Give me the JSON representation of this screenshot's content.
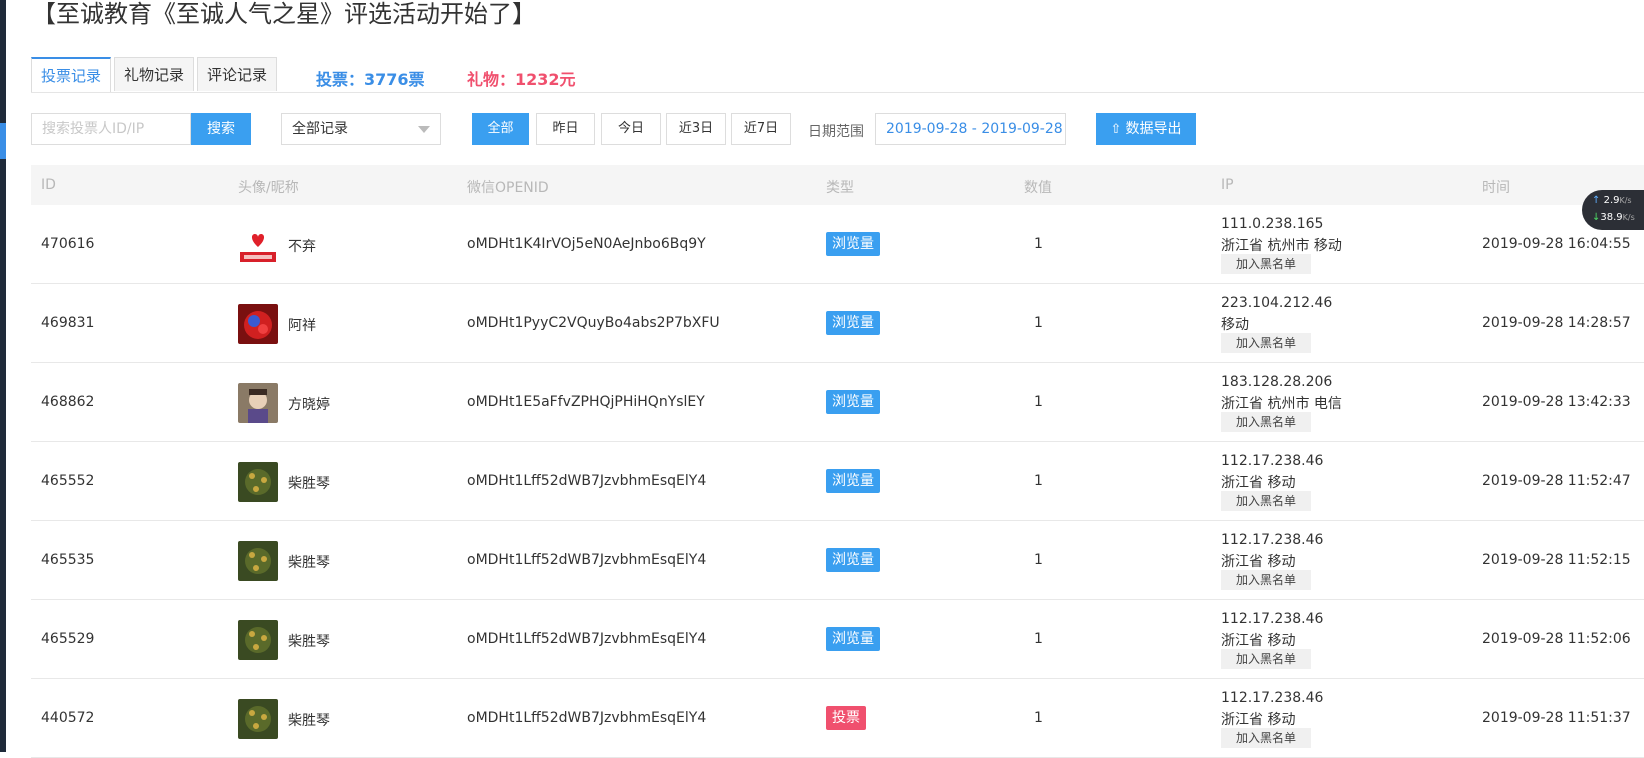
{
  "page": {
    "title": "【至诚教育《至诚人气之星》评选活动开始了】"
  },
  "tabs": [
    {
      "label": "投票记录",
      "active": true
    },
    {
      "label": "礼物记录",
      "active": false
    },
    {
      "label": "评论记录",
      "active": false
    }
  ],
  "stats": {
    "votes": "投票：3776票",
    "gifts": "礼物：1232元"
  },
  "toolbar": {
    "search_placeholder": "搜索投票人ID/IP",
    "search_label": "搜索",
    "record_select": "全部记录",
    "filters": [
      "全部",
      "昨日",
      "今日",
      "近3日",
      "近7日"
    ],
    "active_filter": "全部",
    "date_label": "日期范围",
    "date_range": "2019-09-28 - 2019-09-28",
    "export_label": "数据导出"
  },
  "table": {
    "headers": [
      "ID",
      "头像/昵称",
      "微信OPENID",
      "类型",
      "数值",
      "IP",
      "时间"
    ],
    "blacklist_label": "加入黑名单",
    "rows": [
      {
        "id": "470616",
        "nickname": "不弃",
        "openid": "oMDHt1K4IrVOj5eN0AeJnbo6Bq9Y",
        "type": "浏览量",
        "value": "1",
        "ip": "111.0.238.165",
        "location": "浙江省 杭州市 移动",
        "time": "2019-09-28 16:04:55"
      },
      {
        "id": "469831",
        "nickname": "阿祥",
        "openid": "oMDHt1PyyC2VQuyBo4abs2P7bXFU",
        "type": "浏览量",
        "value": "1",
        "ip": "223.104.212.46",
        "location": "移动",
        "time": "2019-09-28 14:28:57"
      },
      {
        "id": "468862",
        "nickname": "方晓婷",
        "openid": "oMDHt1E5aFfvZPHQjPHiHQnYslEY",
        "type": "浏览量",
        "value": "1",
        "ip": "183.128.28.206",
        "location": "浙江省 杭州市 电信",
        "time": "2019-09-28 13:42:33"
      },
      {
        "id": "465552",
        "nickname": "柴胜琴",
        "openid": "oMDHt1Lff52dWB7JzvbhmEsqElY4",
        "type": "浏览量",
        "value": "1",
        "ip": "112.17.238.46",
        "location": "浙江省 移动",
        "time": "2019-09-28 11:52:47"
      },
      {
        "id": "465535",
        "nickname": "柴胜琴",
        "openid": "oMDHt1Lff52dWB7JzvbhmEsqElY4",
        "type": "浏览量",
        "value": "1",
        "ip": "112.17.238.46",
        "location": "浙江省 移动",
        "time": "2019-09-28 11:52:15"
      },
      {
        "id": "465529",
        "nickname": "柴胜琴",
        "openid": "oMDHt1Lff52dWB7JzvbhmEsqElY4",
        "type": "浏览量",
        "value": "1",
        "ip": "112.17.238.46",
        "location": "浙江省 移动",
        "time": "2019-09-28 11:52:06"
      },
      {
        "id": "440572",
        "nickname": "柴胜琴",
        "openid": "oMDHt1Lff52dWB7JzvbhmEsqElY4",
        "type": "投票",
        "value": "1",
        "ip": "112.17.238.46",
        "location": "浙江省 移动",
        "time": "2019-09-28 11:51:37"
      }
    ]
  },
  "netmon": {
    "up": "2.9",
    "down": "38.9",
    "unit": "K/s"
  },
  "colors": {
    "accent": "#3a9ff0",
    "vote_badge": "#f0506e",
    "gift_text": "#f0506e"
  }
}
